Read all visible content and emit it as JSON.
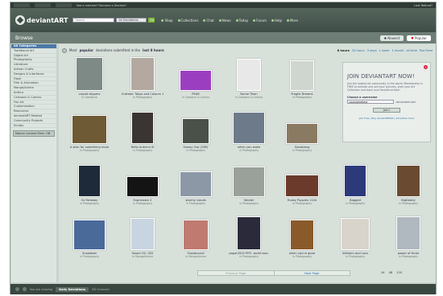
{
  "topstrip": {
    "tabs": [
      "",
      "",
      "",
      "",
      "",
      ""
    ],
    "promo": "Not a member? Become a Deviant!",
    "login": "Last Retired?"
  },
  "header": {
    "logo": "deviantART",
    "search_placeholder": "Search",
    "search_scope": "All Deviations",
    "search_go": "Go",
    "nav": [
      "Shop",
      "Collections",
      "Chat",
      "News",
      "Today",
      "Forum",
      "Help",
      "More"
    ]
  },
  "browsebar": {
    "title": "Browse",
    "sort_newest": "Newest",
    "sort_popular": "Popular"
  },
  "sidebar": {
    "categories": [
      "All Categories",
      "Traditional Art",
      "Digital Art",
      "Photography",
      "Literature",
      "Artisan Crafts",
      "Designs & Interfaces",
      "Flash",
      "Film & Animation",
      "Manga/Anime",
      "Anthro",
      "Cartoons & Comics",
      "Fan Art",
      "Customization",
      "Resources",
      "deviantART Related",
      "Community Projects",
      "Scraps"
    ],
    "filter_toggle": "Mature Content Filter: ON"
  },
  "main": {
    "subhead_prefix": "Most",
    "subhead_bold": "popular",
    "subhead_mid": "deviations submitted in the",
    "subhead_end": "last 8 hours",
    "time_filters": [
      "8 hours",
      "24 hours",
      "3 days",
      "1 week",
      "1 month",
      "all time",
      "Rss Feed"
    ]
  },
  "thumbs": [
    {
      "title": "carpet slippers",
      "cat": "in Literature",
      "color": "#7d8a85"
    },
    {
      "title": "Outtake: Tokyo and Colours 1",
      "cat": "in Photography",
      "color": "#b3a9a1"
    },
    {
      "title": "PEAR",
      "cat": "in Cartoons & Comics",
      "color": "#9b3fc0"
    },
    {
      "title": "Nurse Tikan",
      "cat": "in Cartoons & Comics",
      "color": "#e8e8e8"
    },
    {
      "title": "Fragile Dreams",
      "cat": "in Photography",
      "color": "#cfd6d0"
    },
    {
      "title": "A wish for something more",
      "cat": "in Photography",
      "color": "#6e5a34"
    },
    {
      "title": "Hello Autumn III",
      "cat": "in Photography",
      "color": "#3a3432"
    },
    {
      "title": "Snowy Owl (CBE)",
      "cat": "in Photography",
      "color": "#4a5148"
    },
    {
      "title": "when you wake",
      "cat": "in Photography",
      "color": "#6d7a8a"
    },
    {
      "title": "Snowbang",
      "cat": "in Photography",
      "color": "#8a7a62"
    },
    {
      "title": "Oz Faraway",
      "cat": "in Photography",
      "color": "#1e2a3a"
    },
    {
      "title": "Expression 2",
      "cat": "in Photography",
      "color": "#141414"
    },
    {
      "title": "stormy clouds",
      "cat": "in Photography",
      "color": "#8c98a6"
    },
    {
      "title": "Sender",
      "cat": "in Photography",
      "color": "#9aa09a"
    },
    {
      "title": "Husky Puppies 1104",
      "cat": "in Photography",
      "color": "#6b3a2a"
    },
    {
      "title": "Bagged",
      "cat": "in Photography",
      "color": "#2c3a7a"
    },
    {
      "title": "BigDaddy",
      "cat": "in Photography",
      "color": "#6a4a30"
    },
    {
      "title": "Snowbeat",
      "cat": "in Photography",
      "color": "#4a6a9a"
    },
    {
      "title": "Sword OC: 002",
      "cat": "in Manga/Anime",
      "color": "#c8d4e0"
    },
    {
      "title": "Snowbound",
      "cat": "in Manga/Anime",
      "color": "#c07a70"
    },
    {
      "title": "paper2002 PPG. world tour.",
      "cat": "in Photography",
      "color": "#2a2a3a"
    },
    {
      "title": "when you're gone",
      "cat": "in Photography",
      "color": "#8a5a2a"
    },
    {
      "title": "Wilhelm and Lara",
      "cat": "in Photography",
      "color": "#d8d4cc"
    },
    {
      "title": "power of three",
      "cat": "in Photography",
      "color": "#b0b8c0"
    }
  ],
  "join": {
    "title": "JOIN DEVIANTART NOW!",
    "body": "Join the largest art community in the world. Membership is FREE to deviate and sell your pictures, start your Art Collection and track your favorite artists!",
    "label": "Choose a username",
    "username_value": "yournamehere",
    "domain": ".deviantart.com",
    "button": "Join!",
    "links": "Join Free | Buy deviantWEAR | Advertise more"
  },
  "pager": {
    "prev": "Previous Page",
    "next": "Next Page"
  },
  "counts": [
    "24",
    "48",
    "120"
  ],
  "bottombar": {
    "viewing_label": "You are viewing",
    "current": "Daily Deviations",
    "channel": "DD Channel"
  }
}
